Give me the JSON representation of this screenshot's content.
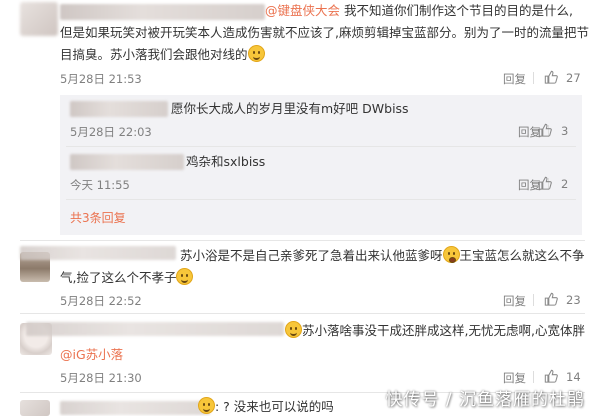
{
  "comment1": {
    "mention": "@键盘侠大会",
    "text_line1": " 我不知道你们制作这个节目的目的是什么,",
    "text_line2": "但是如果玩笑对被开玩笑本人造成伤害就不应该了,麻烦剪辑掉宝蓝部分。别为了一时的流量把节",
    "text_line3": "目搞臭。苏小落我们会跟他对线的",
    "time": "5月28日 21:53",
    "reply_label": "回复",
    "likes": "27"
  },
  "reply1": {
    "text": "愿你长大成人的岁月里没有m好吧 DWbiss",
    "time": "5月28日 22:03",
    "reply_label": "回复",
    "likes": "3"
  },
  "reply2": {
    "text": "鸡杂和sxlbiss",
    "time": "今天 11:55",
    "reply_label": "回复",
    "likes": "2"
  },
  "replies_total": "共3条回复",
  "comment2": {
    "text_line1": "苏小浴是不是自己亲爹死了急着出来认他蓝爹呀",
    "text_line1b": "王宝蓝怎么就这么不争",
    "text_line2": "气,捡了这么个不孝子",
    "time": "5月28日 22:52",
    "reply_label": "回复",
    "likes": "23"
  },
  "comment3": {
    "text_line1": "苏小落啥事没干成还胖成这样,无忧无虑啊,心宽体胖",
    "mention": "@iG苏小落",
    "time": "5月28日 21:30",
    "reply_label": "回复",
    "likes": "14"
  },
  "comment4": {
    "text_line1": ": ? 没来也可以说的吗"
  },
  "watermark": "快传号 / 沉鱼落雁的杜鹃",
  "colors": {
    "link": "#eb7350",
    "meta": "#808080",
    "reply_bg": "#f2f2f5",
    "emoji": "#f7c63a"
  }
}
